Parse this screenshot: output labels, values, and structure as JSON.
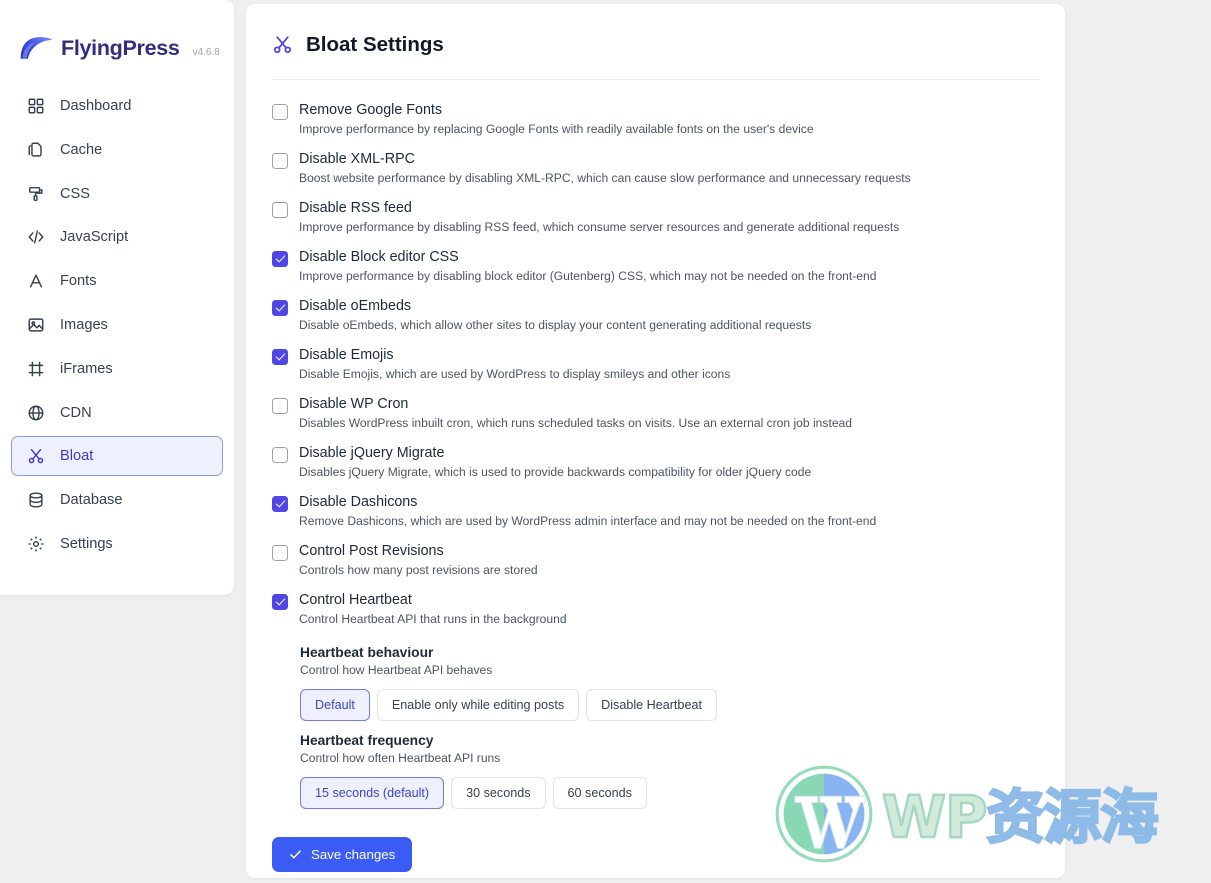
{
  "brand": {
    "name": "FlyingPress",
    "version": "v4.6.8",
    "logo_icon": "wing-swoosh-icon"
  },
  "sidebar": {
    "items": [
      {
        "label": "Dashboard",
        "icon": "grid-icon",
        "active": false
      },
      {
        "label": "Cache",
        "icon": "copy-icon",
        "active": false
      },
      {
        "label": "CSS",
        "icon": "paint-roller-icon",
        "active": false
      },
      {
        "label": "JavaScript",
        "icon": "code-icon",
        "active": false
      },
      {
        "label": "Fonts",
        "icon": "letter-a-icon",
        "active": false
      },
      {
        "label": "Images",
        "icon": "image-icon",
        "active": false
      },
      {
        "label": "iFrames",
        "icon": "frame-icon",
        "active": false
      },
      {
        "label": "CDN",
        "icon": "globe-icon",
        "active": false
      },
      {
        "label": "Bloat",
        "icon": "scissors-icon",
        "active": true
      },
      {
        "label": "Database",
        "icon": "database-icon",
        "active": false
      },
      {
        "label": "Settings",
        "icon": "gear-icon",
        "active": false
      }
    ]
  },
  "page": {
    "title": "Bloat Settings",
    "title_icon": "scissors-icon"
  },
  "settings": [
    {
      "label": "Remove Google Fonts",
      "description": "Improve performance by replacing Google Fonts with readily available fonts on the user's device",
      "checked": false
    },
    {
      "label": "Disable XML-RPC",
      "description": "Boost website performance by disabling XML-RPC, which can cause slow performance and unnecessary requests",
      "checked": false
    },
    {
      "label": "Disable RSS feed",
      "description": "Improve performance by disabling RSS feed, which consume server resources and generate additional requests",
      "checked": false
    },
    {
      "label": "Disable Block editor CSS",
      "description": "Improve performance by disabling block editor (Gutenberg) CSS, which may not be needed on the front-end",
      "checked": true
    },
    {
      "label": "Disable oEmbeds",
      "description": "Disable oEmbeds, which allow other sites to display your content generating additional requests",
      "checked": true
    },
    {
      "label": "Disable Emojis",
      "description": "Disable Emojis, which are used by WordPress to display smileys and other icons",
      "checked": true
    },
    {
      "label": "Disable WP Cron",
      "description": "Disables WordPress inbuilt cron, which runs scheduled tasks on visits. Use an external cron job instead",
      "checked": false
    },
    {
      "label": "Disable jQuery Migrate",
      "description": "Disables jQuery Migrate, which is used to provide backwards compatibility for older jQuery code",
      "checked": false
    },
    {
      "label": "Disable Dashicons",
      "description": "Remove Dashicons, which are used by WordPress admin interface and may not be needed on the front-end",
      "checked": true
    },
    {
      "label": "Control Post Revisions",
      "description": "Controls how many post revisions are stored",
      "checked": false
    },
    {
      "label": "Control Heartbeat",
      "description": "Control Heartbeat API that runs in the background",
      "checked": true
    }
  ],
  "heartbeat_behaviour": {
    "title": "Heartbeat behaviour",
    "description": "Control how Heartbeat API behaves",
    "options": [
      {
        "label": "Default",
        "selected": true
      },
      {
        "label": "Enable only while editing posts",
        "selected": false
      },
      {
        "label": "Disable Heartbeat",
        "selected": false
      }
    ]
  },
  "heartbeat_frequency": {
    "title": "Heartbeat frequency",
    "description": "Control how often Heartbeat API runs",
    "options": [
      {
        "label": "15 seconds (default)",
        "selected": true
      },
      {
        "label": "30 seconds",
        "selected": false
      },
      {
        "label": "60 seconds",
        "selected": false
      }
    ]
  },
  "footer": {
    "save_label": "Save changes",
    "save_icon": "check-icon",
    "accent_color": "#3b5bf5"
  },
  "watermark": {
    "logo_icon": "wordpress-logo-icon",
    "text_latin": "WP",
    "text_cjk": "资源海"
  }
}
